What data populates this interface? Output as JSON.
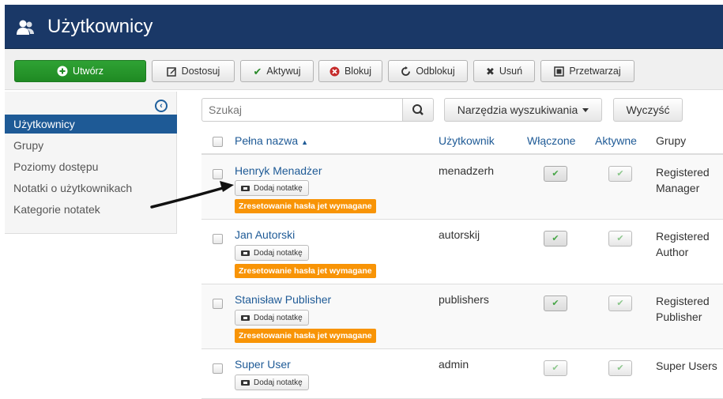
{
  "header": {
    "title": "Użytkownicy",
    "icon": "users-icon",
    "bg_color": "#1a3867"
  },
  "toolbar": {
    "create": "Utwórz",
    "customize": "Dostosuj",
    "activate": "Aktywuj",
    "block": "Blokuj",
    "unblock": "Odblokuj",
    "delete": "Usuń",
    "batch": "Przetwarzaj"
  },
  "sidebar": {
    "items": [
      {
        "label": "Użytkownicy",
        "active": true
      },
      {
        "label": "Grupy"
      },
      {
        "label": "Poziomy dostępu"
      },
      {
        "label": "Notatki o użytkownikach"
      },
      {
        "label": "Kategorie notatek"
      }
    ]
  },
  "filter": {
    "search_placeholder": "Szukaj",
    "tools_label": "Narzędzia wyszukiwania",
    "clear_label": "Wyczyść"
  },
  "table": {
    "headers": {
      "name": "Pełna nazwa",
      "username": "Użytkownik",
      "enabled": "Włączone",
      "activated": "Aktywne",
      "groups": "Grupy"
    },
    "note_label": "Dodaj notatkę",
    "reset_label": "Zresetowanie hasła jet wymagane",
    "rows": [
      {
        "name": "Henryk Menadżer",
        "username": "menadzerh",
        "groups_line1": "Registered",
        "groups_line2": "Manager"
      },
      {
        "name": "Jan Autorski",
        "username": "autorskij",
        "groups_line1": "Registered",
        "groups_line2": "Author"
      },
      {
        "name": "Stanisław Publisher",
        "username": "publishers",
        "groups_line1": "Registered",
        "groups_line2": "Publisher"
      },
      {
        "name": "Super User",
        "username": "admin",
        "groups_line1": "Super Users",
        "groups_line2": ""
      }
    ]
  },
  "colors": {
    "accent": "#1e5a96",
    "create_button": "#2fa234",
    "warning_badge": "#f89406"
  }
}
